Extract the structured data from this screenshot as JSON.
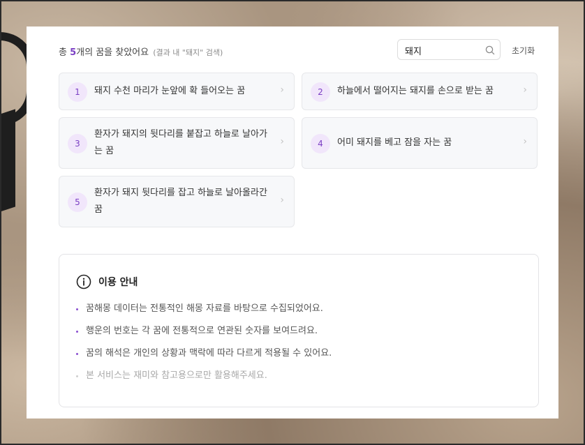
{
  "summary": {
    "prefix": "총 ",
    "count": "5",
    "suffix": "개의 꿈을 찾았어요",
    "hint": "(결과 내 \"돼지\" 검색)"
  },
  "search": {
    "value": "돼지",
    "icon": "search-icon"
  },
  "reset_label": "초기화",
  "results": [
    {
      "num": "1",
      "text": "돼지 수천 마리가 눈앞에 확 들어오는 꿈"
    },
    {
      "num": "2",
      "text": "하늘에서 떨어지는 돼지를 손으로 받는 꿈"
    },
    {
      "num": "3",
      "text": "환자가 돼지의 뒷다리를 붙잡고 하늘로 날아가는 꿈"
    },
    {
      "num": "4",
      "text": "어미 돼지를 베고 잠을 자는 꿈"
    },
    {
      "num": "5",
      "text": "환자가 돼지 뒷다리를 잡고 하늘로 날아올라간 꿈"
    }
  ],
  "chevron": "›",
  "notice": {
    "title": "이용 안내",
    "items": [
      "꿈해몽 데이터는 전통적인 해몽 자료를 바탕으로 수집되었어요.",
      "행운의 번호는 각 꿈에 전통적으로 연관된 숫자를 보여드려요.",
      "꿈의 해석은 개인의 상황과 맥락에 따라 다르게 적용될 수 있어요.",
      "본 서비스는 재미와 참고용으로만 활용해주세요."
    ]
  },
  "colors": {
    "accent": "#7b3fc4",
    "badge_bg": "#f1e6fb",
    "card_bg": "#f7f8fa"
  }
}
